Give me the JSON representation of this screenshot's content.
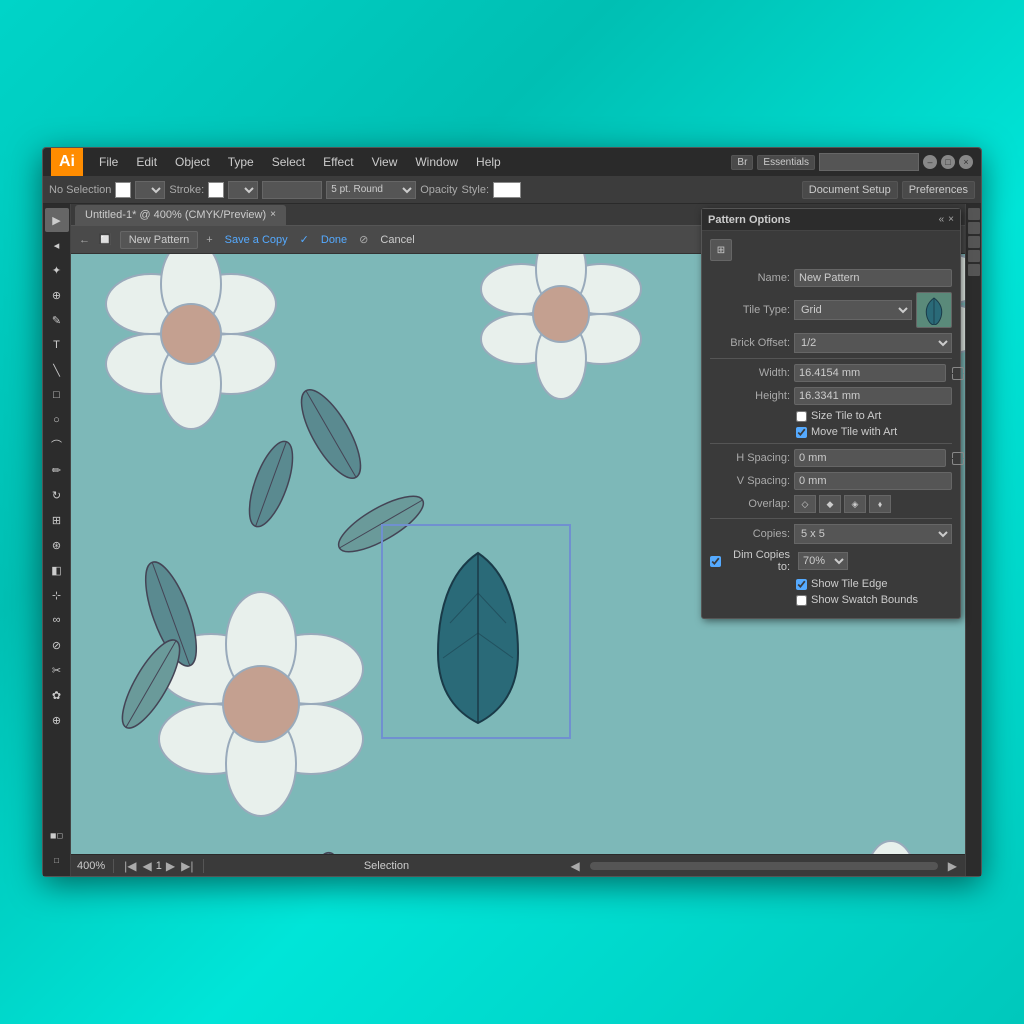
{
  "app": {
    "logo": "Ai",
    "title": "Untitled-1* @ 400% (CMYK/Preview)",
    "tab_close": "×"
  },
  "menu": {
    "items": [
      "File",
      "Edit",
      "Object",
      "Type",
      "Select",
      "Effect",
      "View",
      "Window",
      "Help"
    ]
  },
  "titlebar": {
    "minimize": "–",
    "maximize": "□",
    "close": "×",
    "bridge_btn": "Br",
    "workspace_btn": "Essentials",
    "search_placeholder": ""
  },
  "toolbar": {
    "selection_label": "No Selection",
    "stroke_label": "Stroke:",
    "brush_label": "5 pt. Round",
    "opacity_label": "Opacity",
    "style_label": "Style:",
    "doc_setup_label": "Document Setup",
    "preferences_label": "Preferences"
  },
  "pattern_bar": {
    "new_pattern_label": "New Pattern",
    "save_copy_label": "Save a Copy",
    "done_label": "Done",
    "cancel_label": "Cancel"
  },
  "pattern_panel": {
    "title": "Pattern Options",
    "name_label": "Name:",
    "name_value": "New Pattern",
    "tile_type_label": "Tile Type:",
    "tile_type_value": "Grid",
    "brick_offset_label": "Brick Offset:",
    "brick_offset_value": "1/2",
    "width_label": "Width:",
    "width_value": "16.4154 mm",
    "height_label": "Height:",
    "height_value": "16.3341 mm",
    "size_tile_label": "Size Tile to Art",
    "size_tile_checked": false,
    "move_tile_label": "Move Tile with Art",
    "move_tile_checked": true,
    "h_spacing_label": "H Spacing:",
    "h_spacing_value": "0 mm",
    "v_spacing_label": "V Spacing:",
    "v_spacing_value": "0 mm",
    "overlap_label": "Overlap:",
    "copies_label": "Copies:",
    "copies_value": "5 x 5",
    "dim_copies_label": "Dim Copies to:",
    "dim_copies_checked": true,
    "dim_copies_value": "70%",
    "show_tile_edge_label": "Show Tile Edge",
    "show_tile_edge_checked": true,
    "show_swatch_label": "Show Swatch Bounds",
    "show_swatch_checked": false
  },
  "status_bar": {
    "zoom": "400%",
    "page": "1",
    "tool": "Selection"
  },
  "tools": [
    "▶",
    "◂",
    "⊕",
    "✎",
    "T",
    "╲",
    "□",
    "○",
    "⊘",
    "✂",
    "✿",
    "⌗",
    "◈",
    "↔",
    "⊕",
    "❖",
    "☰",
    "□"
  ]
}
